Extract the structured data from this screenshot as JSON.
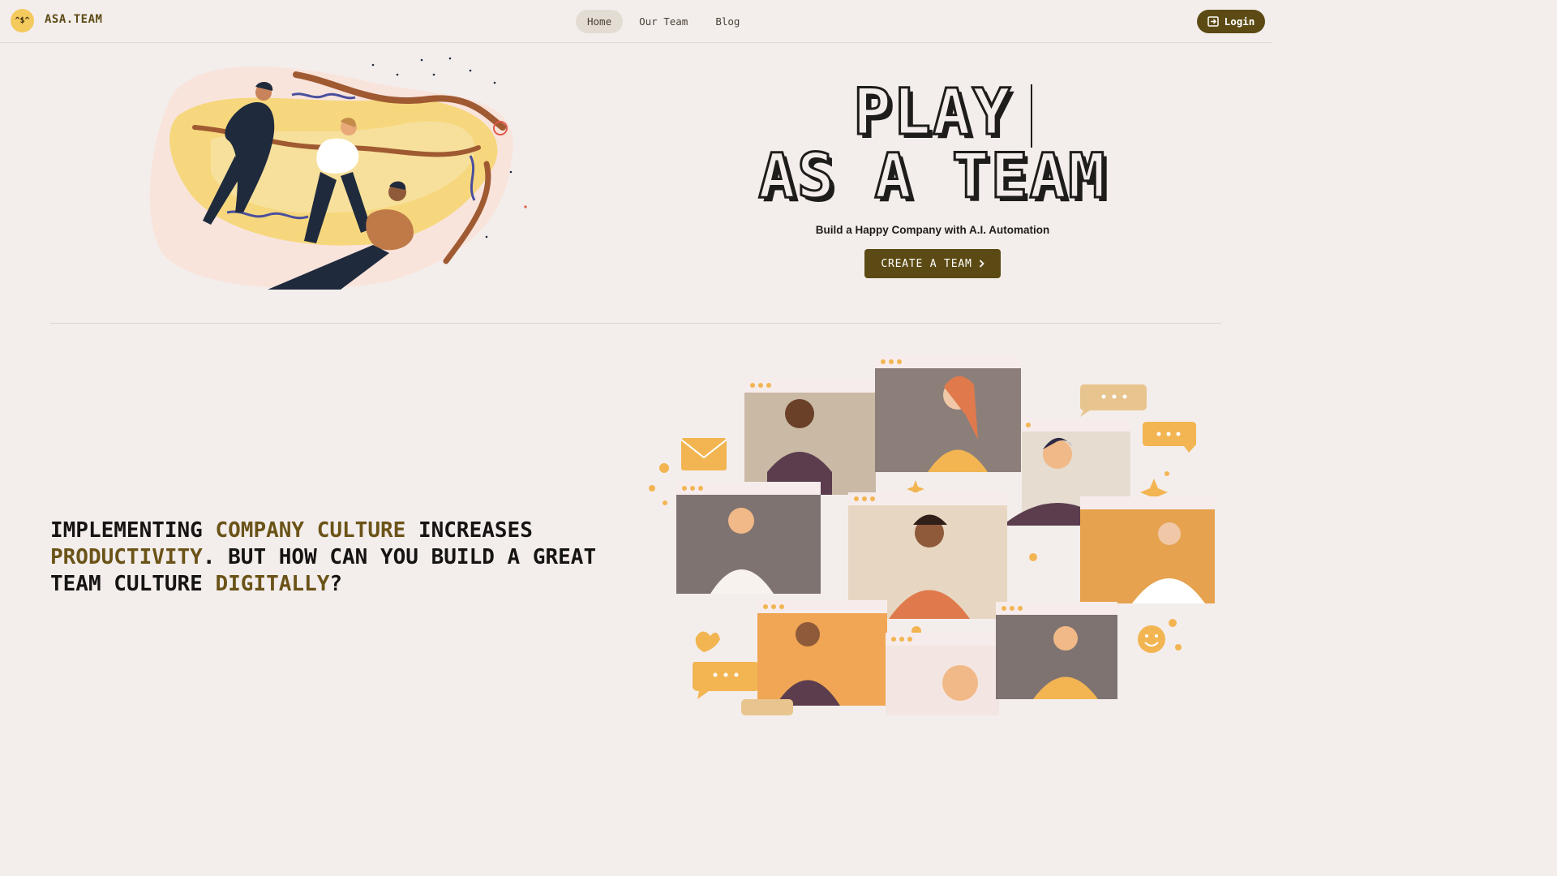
{
  "nav": {
    "logo_face": "^$^",
    "brand": "ASA.TEAM",
    "links": [
      {
        "label": "Home",
        "active": true
      },
      {
        "label": "Our Team",
        "active": false
      },
      {
        "label": "Blog",
        "active": false
      }
    ],
    "login_label": "Login"
  },
  "hero": {
    "title_line1": "PLAY",
    "title_line2": "AS A TEAM",
    "subtitle": "Build a Happy Company with A.I. Automation",
    "cta_label": "CREATE A TEAM",
    "cta_icon": "chevron-right-icon"
  },
  "culture": {
    "p1": "Implementing ",
    "h1": "company culture",
    "p2": " increases ",
    "h2": "productivity",
    "p3": ". But how can you build a great team culture ",
    "h3": "digitally",
    "p4": "?"
  },
  "colors": {
    "accent": "#5c4a14",
    "background": "#f3eeec",
    "logo_badge": "#f4c95d",
    "highlight_text": "#6b5318"
  }
}
